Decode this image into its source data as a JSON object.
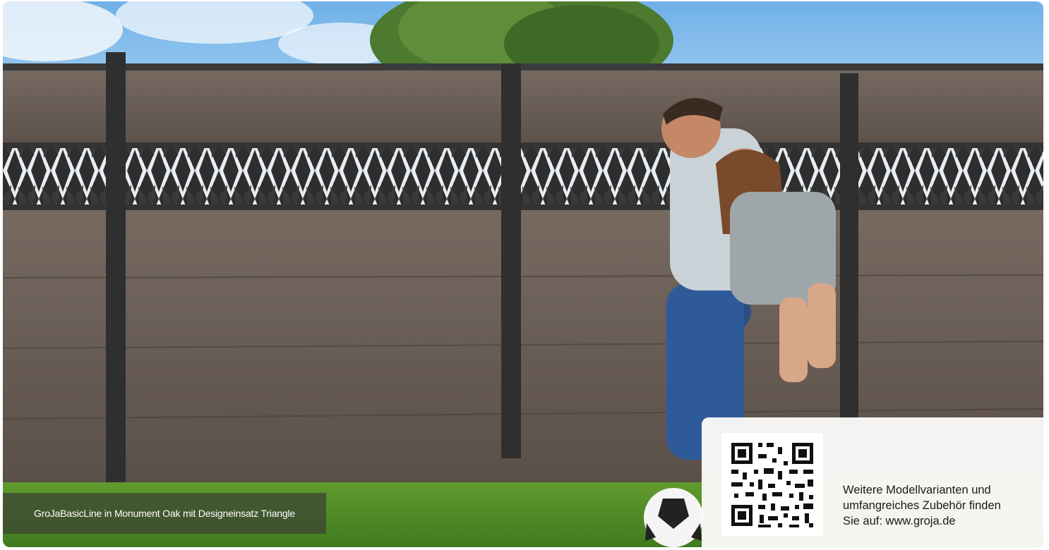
{
  "caption": "GroJaBasicLine in Monument Oak mit Designeinsatz Triangle",
  "info": {
    "line1": "Weitere Modellvarianten und",
    "line2": "umfangreiches Zubehör finden",
    "line3": "Sie auf: www.groja.de"
  },
  "colors": {
    "sky": "#9cc8ee",
    "fence_wood": "#6b5f57",
    "post": "#3a3a3a",
    "lawn": "#5f9a2c",
    "caption_bg": "#3c4832"
  }
}
